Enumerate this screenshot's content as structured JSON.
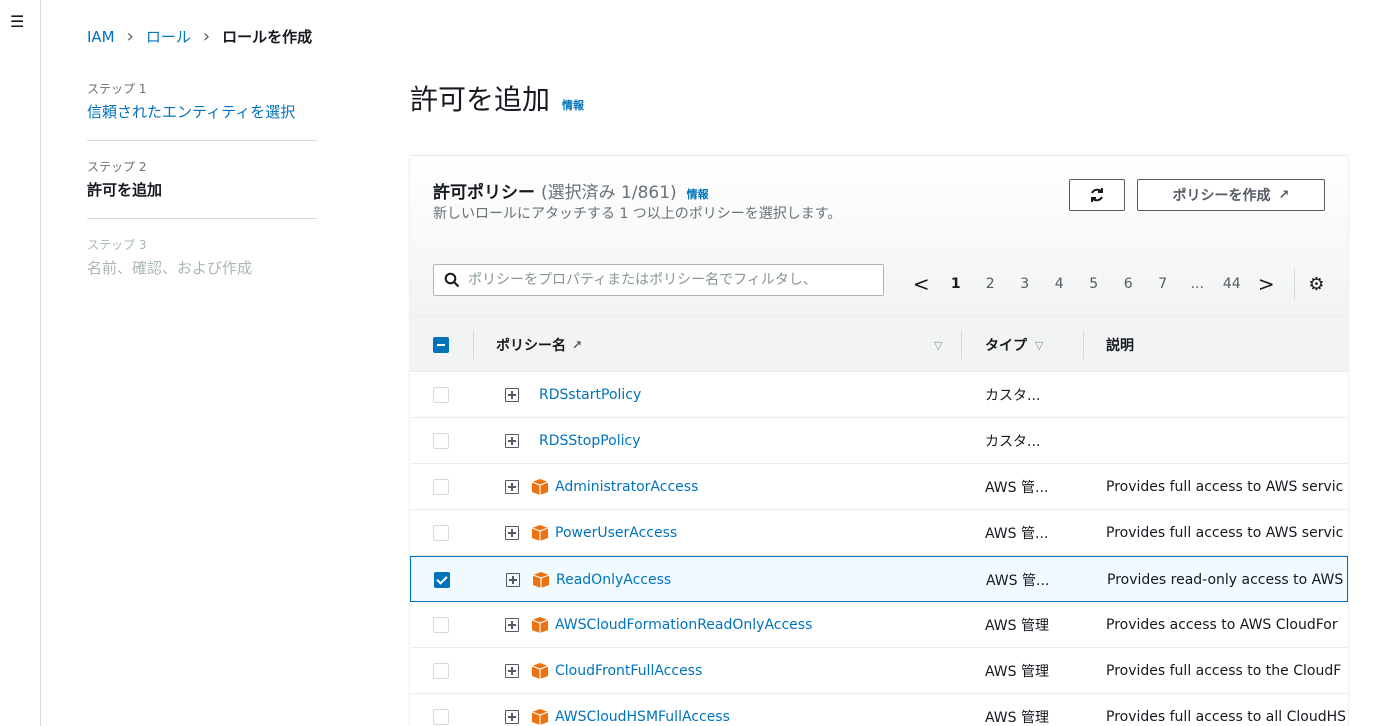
{
  "nav": {
    "menu_icon": "hamburger-icon"
  },
  "breadcrumb": {
    "items": [
      "IAM",
      "ロール",
      "ロールを作成"
    ]
  },
  "steps": [
    {
      "num": "ステップ 1",
      "title": "信頼されたエンティティを選択",
      "state": "link"
    },
    {
      "num": "ステップ 2",
      "title": "許可を追加",
      "state": "active"
    },
    {
      "num": "ステップ 3",
      "title": "名前、確認、および作成",
      "state": "disabled"
    }
  ],
  "page": {
    "title": "許可を追加",
    "info": "情報"
  },
  "policies": {
    "title": "許可ポリシー",
    "count": "(選択済み 1/861)",
    "info": "情報",
    "description": "新しいロールにアタッチする 1 つ以上のポリシーを選択します。",
    "refresh_icon": "refresh-icon",
    "create_label": "ポリシーを作成",
    "create_icon": "external-link-icon",
    "search_placeholder": "ポリシーをプロパティまたはポリシー名でフィルタし、",
    "pagination": {
      "prev": "<",
      "pages": [
        "1",
        "2",
        "3",
        "4",
        "5",
        "6",
        "7",
        "...",
        "44"
      ],
      "current": "1",
      "next": ">",
      "settings_icon": "gear-icon"
    },
    "columns": {
      "name": "ポリシー名",
      "type": "タイプ",
      "description": "説明"
    },
    "rows": [
      {
        "name": "RDSstartPolicy",
        "type": "カスタ...",
        "description": "",
        "aws_managed": false,
        "checked": false
      },
      {
        "name": "RDSStopPolicy",
        "type": "カスタ...",
        "description": "",
        "aws_managed": false,
        "checked": false
      },
      {
        "name": "AdministratorAccess",
        "type": "AWS 管...",
        "description": "Provides full access to AWS servic",
        "aws_managed": true,
        "checked": false
      },
      {
        "name": "PowerUserAccess",
        "type": "AWS 管...",
        "description": "Provides full access to AWS servic",
        "aws_managed": true,
        "checked": false
      },
      {
        "name": "ReadOnlyAccess",
        "type": "AWS 管...",
        "description": "Provides read-only access to AWS",
        "aws_managed": true,
        "checked": true
      },
      {
        "name": "AWSCloudFormationReadOnlyAccess",
        "type": "AWS 管理",
        "description": "Provides access to AWS CloudFor",
        "aws_managed": true,
        "checked": false
      },
      {
        "name": "CloudFrontFullAccess",
        "type": "AWS 管理",
        "description": "Provides full access to the CloudF",
        "aws_managed": true,
        "checked": false
      },
      {
        "name": "AWSCloudHSMFullAccess",
        "type": "AWS 管理",
        "description": "Provides full access to all CloudHS",
        "aws_managed": true,
        "checked": false
      }
    ]
  },
  "colors": {
    "link": "#0073bb",
    "aws_orange": "#ec7211",
    "header_bg": "#f2f3f3"
  }
}
